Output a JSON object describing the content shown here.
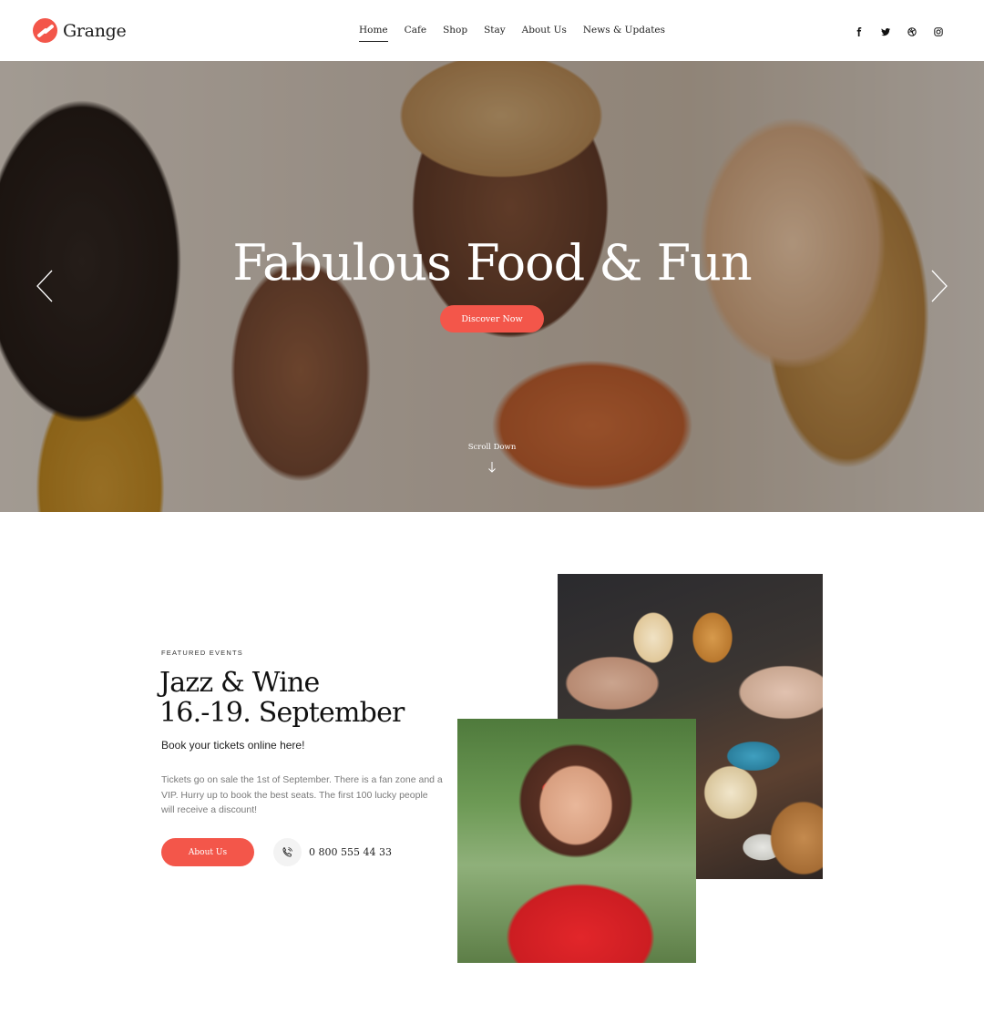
{
  "brand": {
    "name": "Grange",
    "accent": "#f3564a"
  },
  "nav": {
    "items": [
      {
        "label": "Home",
        "active": true
      },
      {
        "label": "Cafe",
        "active": false
      },
      {
        "label": "Shop",
        "active": false
      },
      {
        "label": "Stay",
        "active": false
      },
      {
        "label": "About Us",
        "active": false
      },
      {
        "label": "News & Updates",
        "active": false
      }
    ]
  },
  "social": [
    "facebook-icon",
    "twitter-icon",
    "dribbble-icon",
    "instagram-icon"
  ],
  "hero": {
    "title": "Fabulous Food & Fun",
    "cta": "Discover Now",
    "scroll_label": "Scroll Down"
  },
  "featured": {
    "eyebrow": "FEATURED EVENTS",
    "title_line1": "Jazz & Wine",
    "title_line2": "16.-19. September",
    "subtitle": "Book your tickets online here!",
    "description": "Tickets go on sale the 1st of September. There is a fan zone and a VIP.  Hurry up to book the best seats. The first 100 lucky people will receive a discount!",
    "button": "About Us",
    "phone": "0 800 555 44 33"
  }
}
